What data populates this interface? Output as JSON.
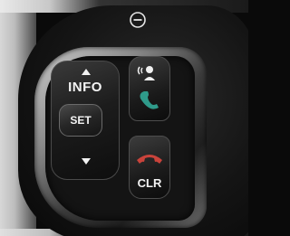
{
  "controls": {
    "info_label": "INFO",
    "set_label": "SET",
    "clr_label": "CLR"
  },
  "icons": [
    "minus-circle-icon",
    "arrow-up-icon",
    "arrow-down-icon",
    "voice-command-icon",
    "phone-answer-icon",
    "phone-hangup-icon"
  ],
  "colors": {
    "label": "#f4f4f4",
    "answer_green": "#2f9a8a",
    "hangup_red": "#c9433b",
    "trim_silver": "#b8b8b8"
  }
}
